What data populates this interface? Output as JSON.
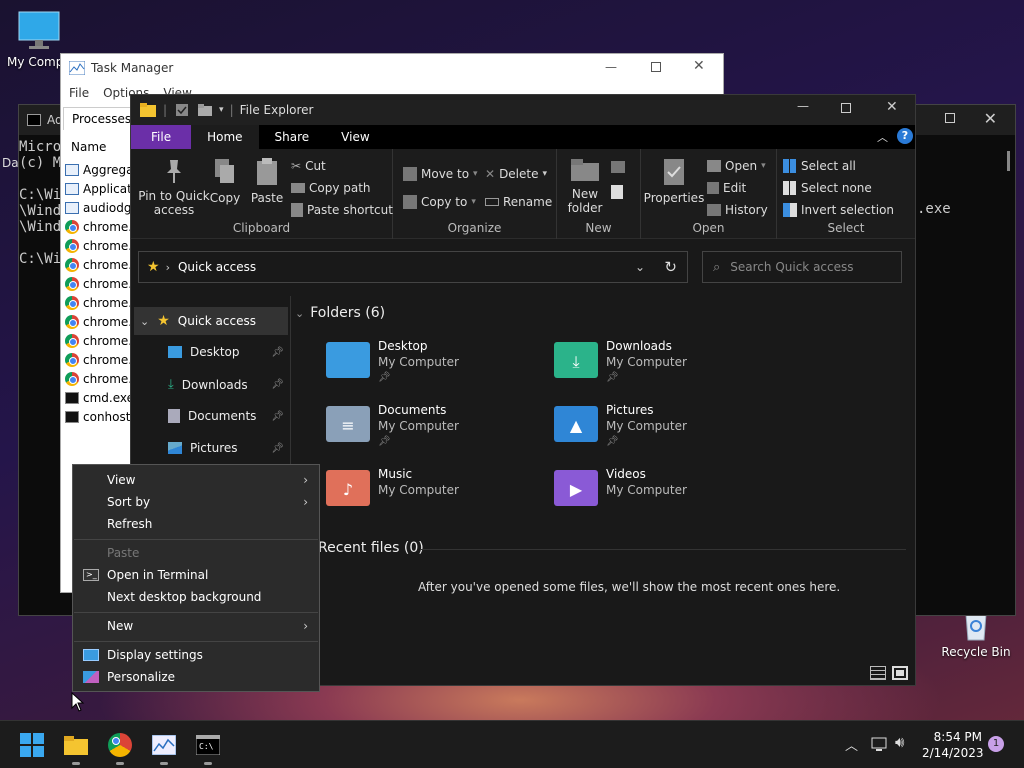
{
  "desktop": {
    "my_computer_label": "My Compu",
    "recycle_bin_label": "Recycle Bin",
    "da_label": "Da"
  },
  "cmd": {
    "title": "Ad",
    "lines": [
      "Micro",
      "(c) M",
      "",
      "C:\\Wi",
      "\\Wind",
      "\\Wind",
      "",
      "C:\\Wi"
    ],
    "right_text": ".exe"
  },
  "task_manager": {
    "title": "Task Manager",
    "menu": [
      "File",
      "Options",
      "View"
    ],
    "tab": "Processes",
    "column": "Name",
    "rows": [
      {
        "icon": "app-icon",
        "name": "Aggregat"
      },
      {
        "icon": "app-icon",
        "name": "Applicati"
      },
      {
        "icon": "app-icon",
        "name": "audiodg."
      },
      {
        "icon": "chrome-icon",
        "name": "chrome.e"
      },
      {
        "icon": "chrome-icon",
        "name": "chrome.e"
      },
      {
        "icon": "chrome-icon",
        "name": "chrome.e"
      },
      {
        "icon": "chrome-icon",
        "name": "chrome.e"
      },
      {
        "icon": "chrome-icon",
        "name": "chrome.e"
      },
      {
        "icon": "chrome-icon",
        "name": "chrome.e"
      },
      {
        "icon": "chrome-icon",
        "name": "chrome.e"
      },
      {
        "icon": "chrome-icon",
        "name": "chrome.e"
      },
      {
        "icon": "chrome-icon",
        "name": "chrome.e"
      },
      {
        "icon": "cmd-icon",
        "name": "cmd.exe"
      },
      {
        "icon": "cmd-icon",
        "name": "conhost."
      }
    ]
  },
  "explorer": {
    "title": "File Explorer",
    "tabs": {
      "file": "File",
      "home": "Home",
      "share": "Share",
      "view": "View"
    },
    "ribbon": {
      "pin": "Pin to Quick access",
      "copy": "Copy",
      "paste": "Paste",
      "cut": "Cut",
      "copy_path": "Copy path",
      "paste_shortcut": "Paste shortcut",
      "clipboard": "Clipboard",
      "move_to": "Move to",
      "copy_to": "Copy to",
      "delete": "Delete",
      "rename": "Rename",
      "organize": "Organize",
      "new_folder": "New folder",
      "new": "New",
      "properties": "Properties",
      "open": "Open",
      "edit": "Edit",
      "history": "History",
      "open_group": "Open",
      "select_all": "Select all",
      "select_none": "Select none",
      "invert": "Invert selection",
      "select": "Select"
    },
    "address": "Quick access",
    "search_placeholder": "Search Quick access",
    "nav": [
      {
        "icon": "star-icon",
        "label": "Quick access"
      },
      {
        "icon": "desktop-icon",
        "label": "Desktop"
      },
      {
        "icon": "download-icon",
        "label": "Downloads"
      },
      {
        "icon": "document-icon",
        "label": "Documents"
      },
      {
        "icon": "pictures-icon",
        "label": "Pictures"
      }
    ],
    "folders_header": "Folders (6)",
    "folders": [
      {
        "name": "Desktop",
        "location": "My Computer",
        "color": "#3a9be0"
      },
      {
        "name": "Downloads",
        "location": "My Computer",
        "color": "#2bb38a"
      },
      {
        "name": "Documents",
        "location": "My Computer",
        "color": "#8aa0b8"
      },
      {
        "name": "Pictures",
        "location": "My Computer",
        "color": "#2f86d6"
      },
      {
        "name": "Music",
        "location": "My Computer",
        "color": "#e0705a"
      },
      {
        "name": "Videos",
        "location": "My Computer",
        "color": "#8a5ad6"
      }
    ],
    "recent_header": "Recent files (0)",
    "recent_empty": "After you've opened some files, we'll show the most recent ones here."
  },
  "context_menu": {
    "view": "View",
    "sort_by": "Sort by",
    "refresh": "Refresh",
    "paste": "Paste",
    "open_terminal": "Open in Terminal",
    "next_bg": "Next desktop background",
    "new": "New",
    "display_settings": "Display settings",
    "personalize": "Personalize"
  },
  "taskbar": {
    "time": "8:54 PM",
    "date": "2/14/2023",
    "notification_count": "1"
  },
  "colors": {
    "accent": "#7a3fb0",
    "file_tab": "#6b2fa8",
    "link_blue": "#2a7ad6"
  }
}
